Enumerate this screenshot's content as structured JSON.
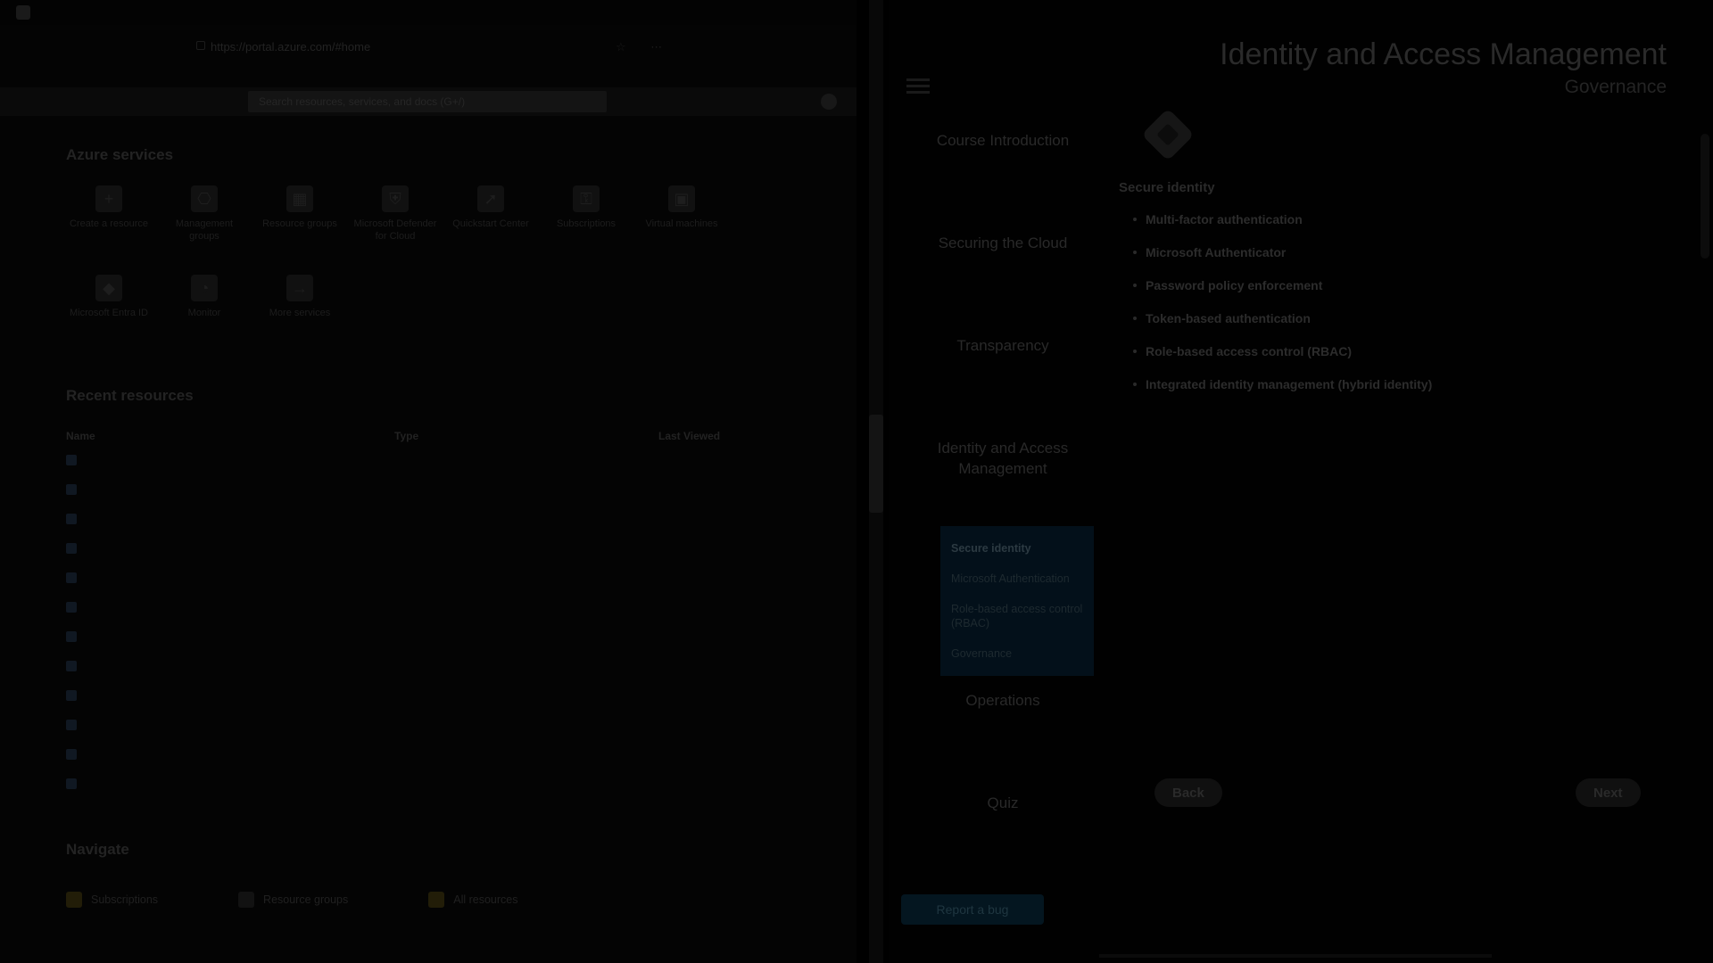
{
  "azure": {
    "url": "https://portal.azure.com/#home",
    "search_placeholder": "Search resources, services, and docs (G+/)",
    "services_title": "Azure services",
    "services": [
      {
        "label": "Create a resource",
        "icon": "plus-icon"
      },
      {
        "label": "Management groups",
        "icon": "management-groups-icon"
      },
      {
        "label": "Resource groups",
        "icon": "resource-groups-icon"
      },
      {
        "label": "Microsoft Defender for Cloud",
        "icon": "defender-shield-icon"
      },
      {
        "label": "Quickstart Center",
        "icon": "rocket-icon"
      },
      {
        "label": "Subscriptions",
        "icon": "key-icon"
      },
      {
        "label": "Virtual machines",
        "icon": "virtual-machine-icon"
      },
      {
        "label": "Microsoft Entra ID",
        "icon": "entra-id-icon"
      },
      {
        "label": "Monitor",
        "icon": "monitor-icon"
      },
      {
        "label": "More services",
        "icon": "arrow-right-icon"
      }
    ],
    "recent_title": "Recent resources",
    "recent_headers": [
      "Name",
      "Type",
      "Last Viewed"
    ],
    "recent_rows": [
      [
        "",
        "",
        ""
      ],
      [
        "",
        "",
        ""
      ],
      [
        "",
        "",
        ""
      ],
      [
        "",
        "",
        ""
      ],
      [
        "",
        "",
        ""
      ],
      [
        "",
        "",
        ""
      ],
      [
        "",
        "",
        ""
      ],
      [
        "",
        "",
        ""
      ],
      [
        "",
        "",
        ""
      ],
      [
        "",
        "",
        ""
      ],
      [
        "",
        "",
        ""
      ],
      [
        "",
        "",
        ""
      ]
    ],
    "navigate_title": "Navigate",
    "navigate": [
      {
        "label": "Subscriptions",
        "icon": "key-icon"
      },
      {
        "label": "Resource groups",
        "icon": "resource-groups-icon"
      },
      {
        "label": "All resources",
        "icon": "grid-icon"
      }
    ]
  },
  "course": {
    "title": "Identity and Access Management",
    "subtitle": "Governance",
    "toc": [
      {
        "title": "Course Introduction",
        "sub": "",
        "two_line": false
      },
      {
        "title": "Securing the Cloud",
        "sub": "",
        "two_line": false
      },
      {
        "title": "Transparency",
        "sub": "",
        "two_line": false
      },
      {
        "title": "Identity and Access Management",
        "sub": "",
        "two_line": true
      }
    ],
    "toc_sub": [
      {
        "label": "Secure identity",
        "active": true
      },
      {
        "label": "Microsoft Authentication",
        "active": false
      },
      {
        "label": "Role-based access control (RBAC)",
        "active": false
      },
      {
        "label": "Governance",
        "active": false
      }
    ],
    "toc_after": [
      {
        "title": "Operations",
        "sub": ""
      },
      {
        "title": "Quiz",
        "sub": ""
      }
    ],
    "section_heading": "Secure identity",
    "intro": "",
    "bullets": [
      {
        "term": "Multi-factor authentication",
        "text": ""
      },
      {
        "term": "Microsoft Authenticator",
        "text": ""
      },
      {
        "term": "Password policy enforcement",
        "text": ""
      },
      {
        "term": "Token-based authentication",
        "text": ""
      },
      {
        "term": "Role-based access control (RBAC)",
        "text": ""
      },
      {
        "term": "Integrated identity management (hybrid identity)",
        "text": ""
      }
    ],
    "back_label": "Back",
    "next_label": "Next",
    "cta_label": "Report a bug"
  },
  "colors": {
    "page_bg": "#000000",
    "toc_sub_bg": "#03101a",
    "cta_bg": "#041620"
  }
}
